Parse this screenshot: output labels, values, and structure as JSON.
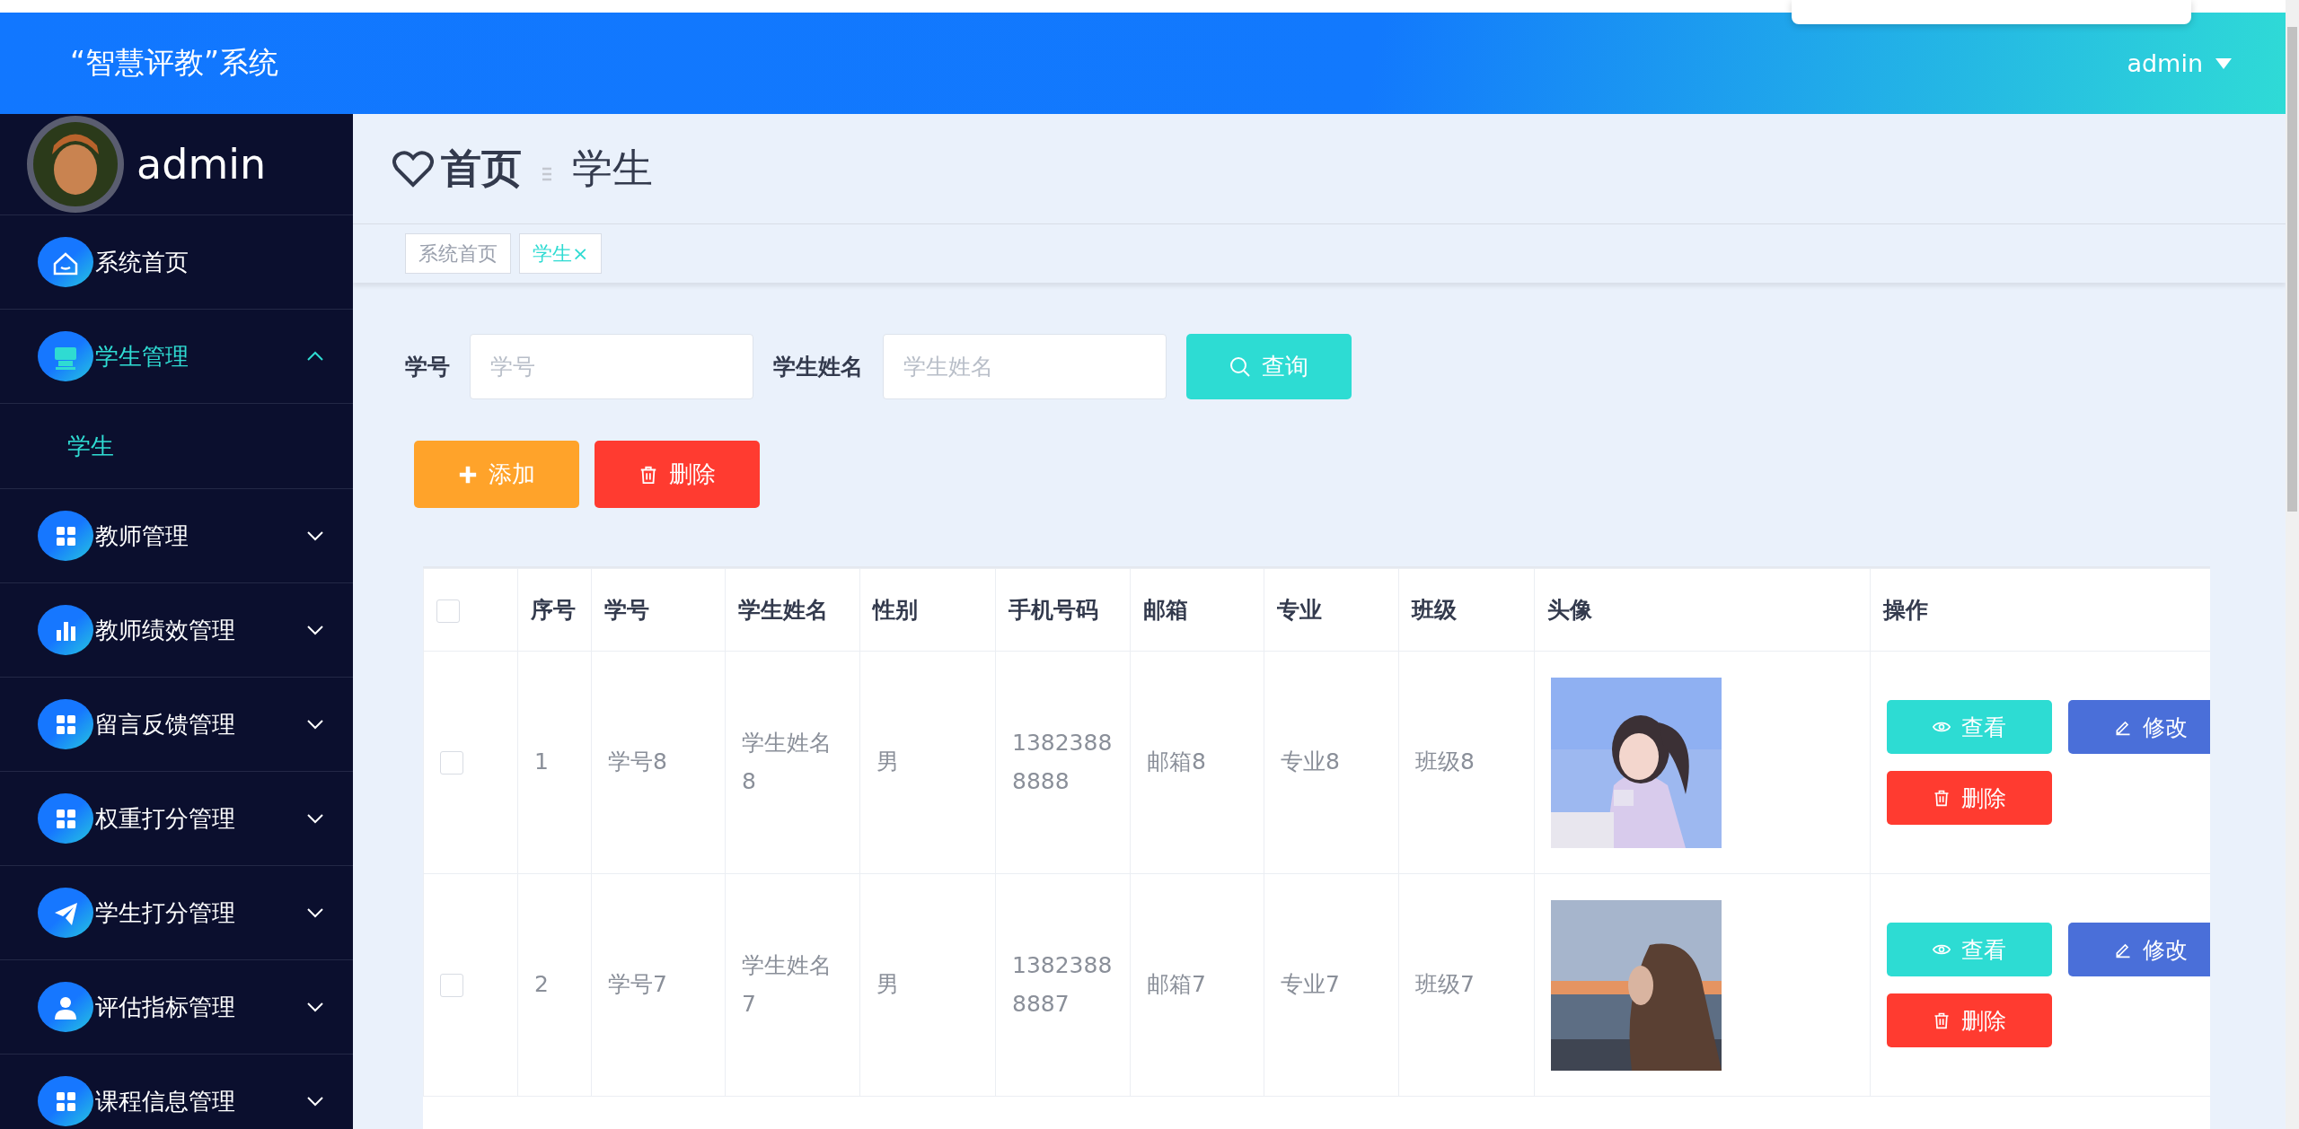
{
  "header": {
    "title": "“智慧评教”系统",
    "user": "admin"
  },
  "sidebar": {
    "user": "admin",
    "items": [
      {
        "label": "系统首页",
        "kind": "home",
        "selected": false
      },
      {
        "label": "学生管理",
        "kind": "store",
        "selected": true,
        "expanded": true,
        "children": [
          {
            "label": "学生",
            "selected": true
          }
        ]
      },
      {
        "label": "教师管理",
        "kind": "grid",
        "selected": false,
        "expanded": false
      },
      {
        "label": "教师绩效管理",
        "kind": "chart",
        "selected": false,
        "expanded": false
      },
      {
        "label": "留言反馈管理",
        "kind": "grid",
        "selected": false,
        "expanded": false
      },
      {
        "label": "权重打分管理",
        "kind": "grid",
        "selected": false,
        "expanded": false
      },
      {
        "label": "学生打分管理",
        "kind": "plane",
        "selected": false,
        "expanded": false
      },
      {
        "label": "评估指标管理",
        "kind": "person",
        "selected": false,
        "expanded": false
      },
      {
        "label": "课程信息管理",
        "kind": "grid",
        "selected": false,
        "expanded": false
      }
    ]
  },
  "breadcrumb": {
    "home": "首页",
    "current": "学生"
  },
  "tabs": [
    {
      "label": "系统首页",
      "selected": false
    },
    {
      "label": "学生",
      "selected": true,
      "close": "×"
    }
  ],
  "search": {
    "fields": [
      {
        "label": "学号",
        "placeholder": "学号"
      },
      {
        "label": "学生姓名",
        "placeholder": "学生姓名"
      }
    ],
    "button": "查询"
  },
  "actions": [
    {
      "label": "添加",
      "kind": "add"
    },
    {
      "label": "删除",
      "kind": "delete"
    }
  ],
  "table": {
    "select_all": false,
    "columns": [
      "序号",
      "学号",
      "学生姓名",
      "性别",
      "手机号码",
      "邮箱",
      "专业",
      "班级",
      "头像",
      "操作"
    ],
    "rows": [
      {
        "checked": false,
        "cells": [
          "1",
          "学号8",
          "学生姓名8",
          "男",
          "13823888888",
          "邮箱8",
          "专业8",
          "班级8"
        ],
        "photo": {
          "kind": "picture"
        },
        "buttons": [
          {
            "label": "查看",
            "kind": "view"
          },
          {
            "label": "修改",
            "kind": "edit"
          },
          {
            "label": "删除",
            "kind": "delete"
          }
        ]
      },
      {
        "checked": false,
        "cells": [
          "2",
          "学号7",
          "学生姓名7",
          "男",
          "13823888887",
          "邮箱7",
          "专业7",
          "班级7"
        ],
        "photo": {
          "kind": "picture"
        },
        "buttons": [
          {
            "label": "查看",
            "kind": "view"
          },
          {
            "label": "修改",
            "kind": "edit"
          },
          {
            "label": "删除",
            "kind": "delete"
          }
        ]
      }
    ]
  }
}
